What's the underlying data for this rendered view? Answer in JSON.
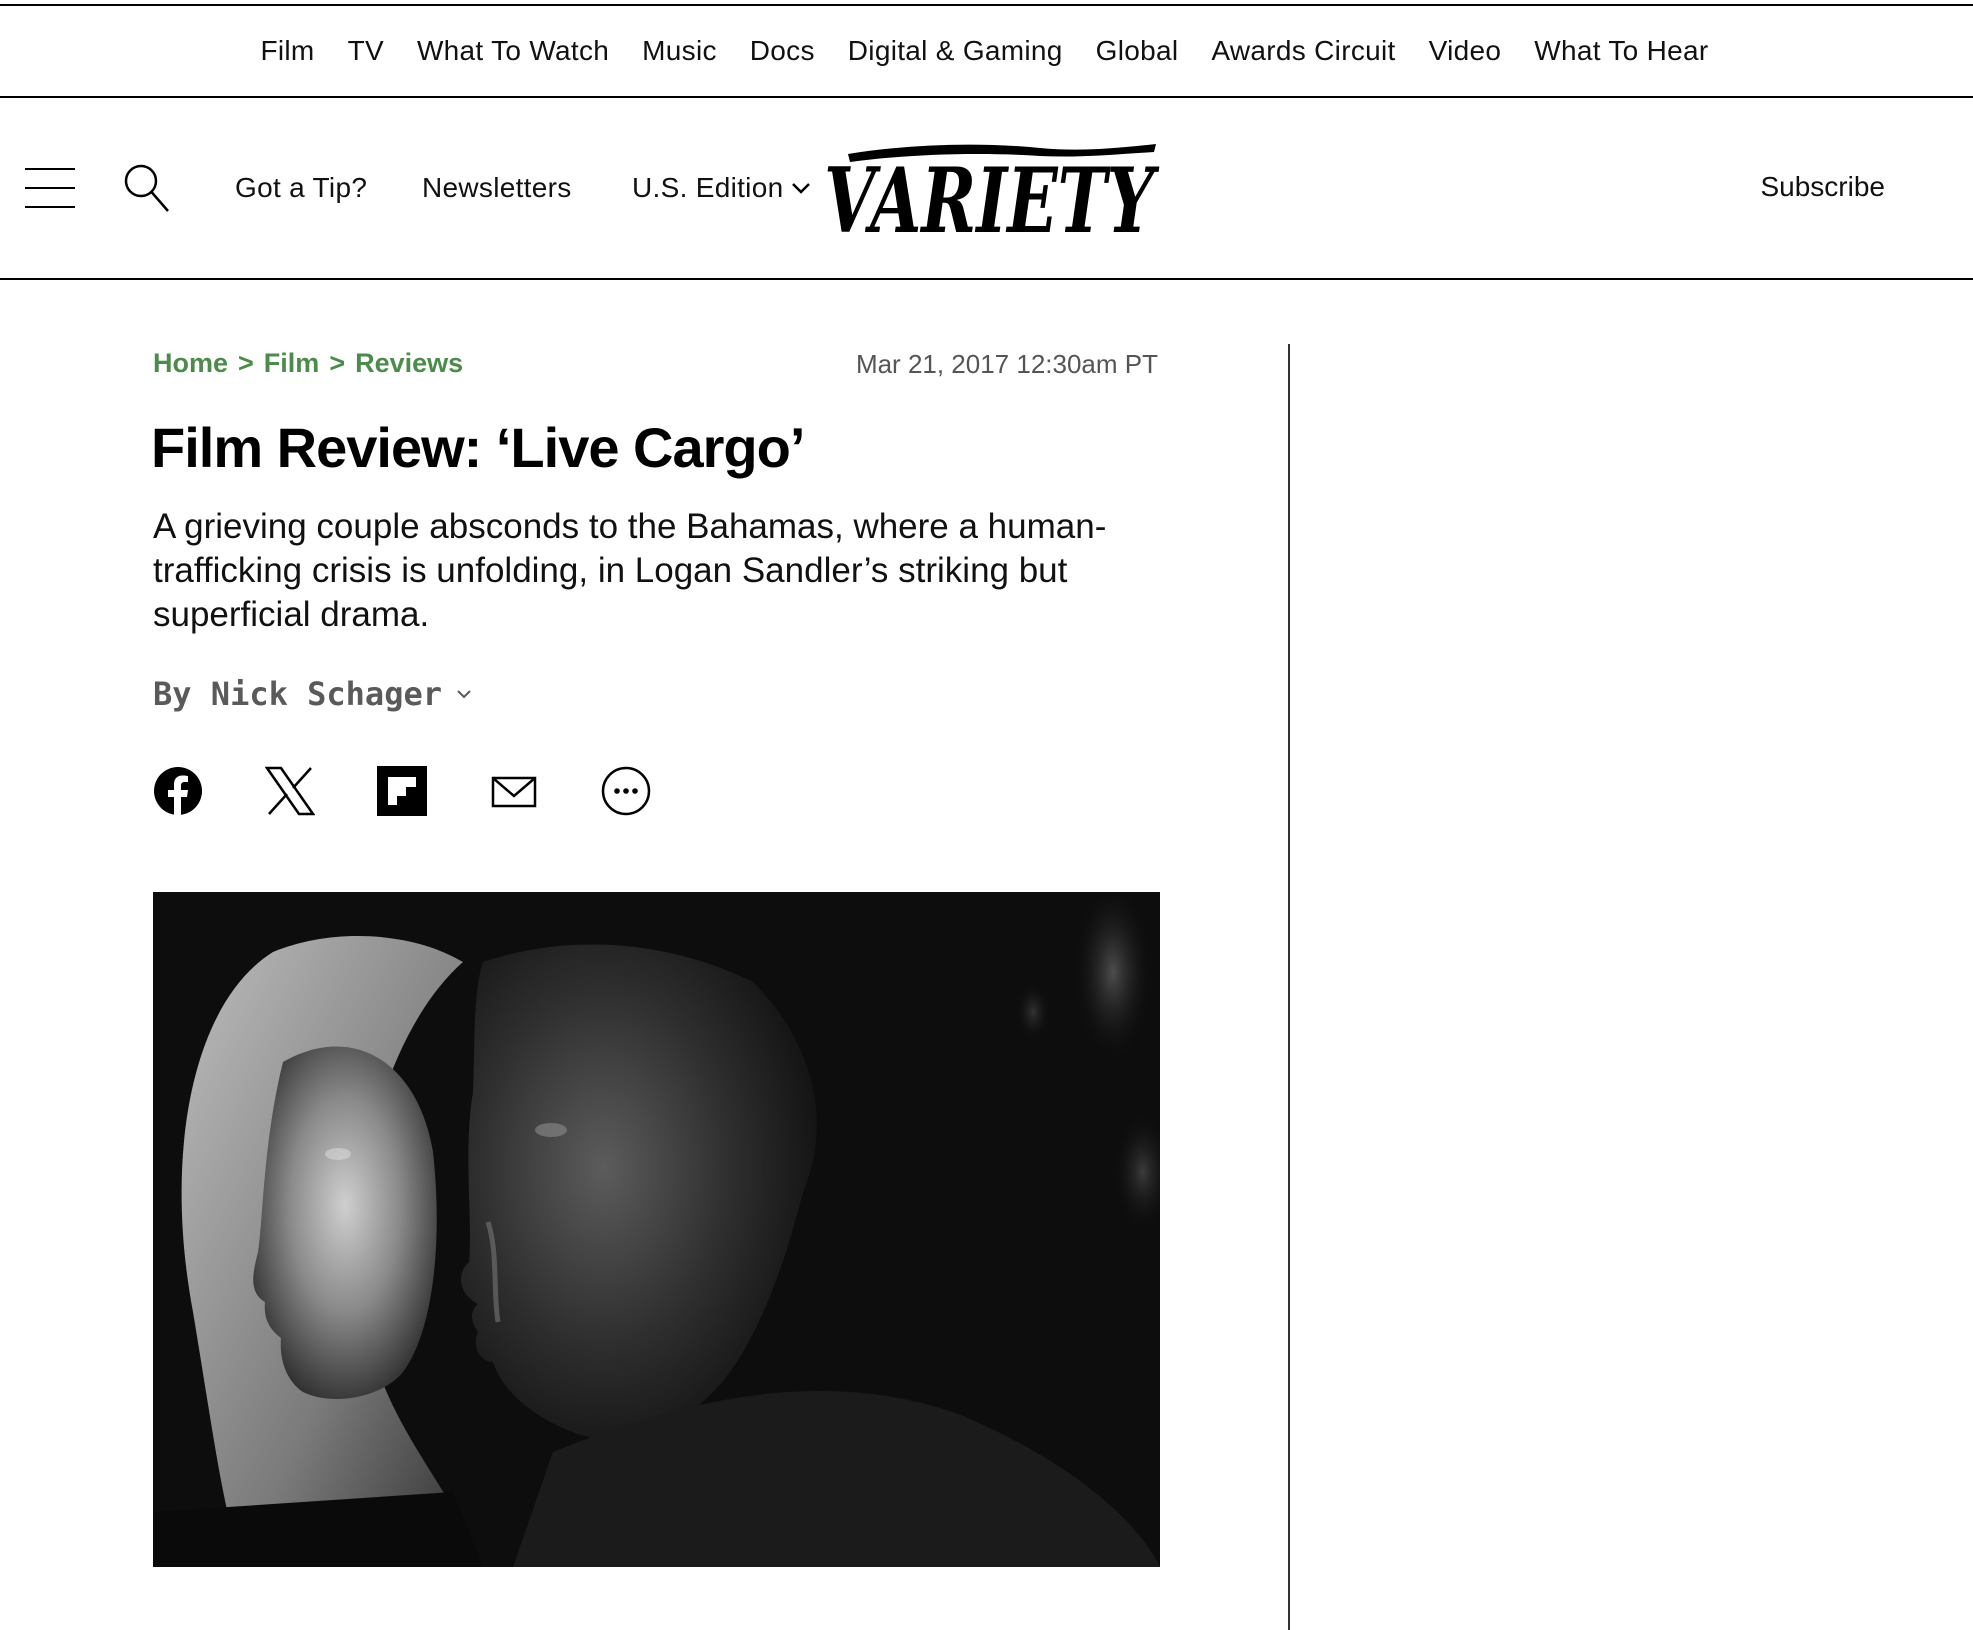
{
  "top_nav": {
    "items": [
      "Film",
      "TV",
      "What To Watch",
      "Music",
      "Docs",
      "Digital & Gaming",
      "Global",
      "Awards Circuit",
      "Video",
      "What To Hear"
    ]
  },
  "header": {
    "menu_icon": "hamburger-menu-icon",
    "search_icon": "search-icon",
    "got_a_tip": "Got a Tip?",
    "newsletters": "Newsletters",
    "edition": "U.S. Edition",
    "edition_icon": "chevron-down-icon",
    "logo_text": "VARIETY",
    "subscribe": "Subscribe"
  },
  "article": {
    "breadcrumb": [
      "Home",
      "Film",
      "Reviews"
    ],
    "breadcrumb_separator": ">",
    "timestamp": "Mar 21, 2017 12:30am PT",
    "title": "Film Review: ‘Live Cargo’",
    "dek": "A grieving couple absconds to the Bahamas, where a human-trafficking crisis is unfolding, in Logan Sandler’s striking but superficial drama.",
    "byline": "By Nick Schager",
    "share": [
      "facebook-icon",
      "x-icon",
      "flipboard-icon",
      "email-icon",
      "more-icon"
    ],
    "hero_image": "black-and-white-couple-photo"
  },
  "colors": {
    "breadcrumb": "#4c8b4c",
    "byline": "#5a5a5a",
    "timestamp": "#555555"
  }
}
